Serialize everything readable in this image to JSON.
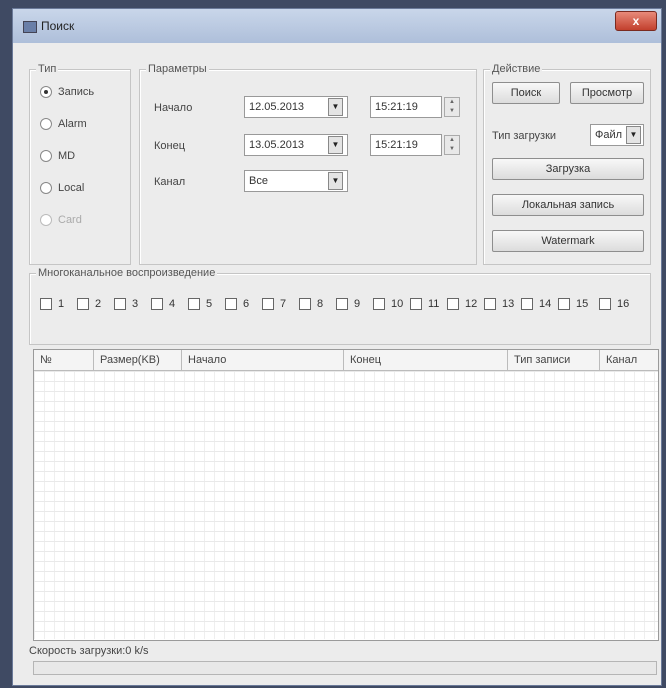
{
  "window": {
    "title": "Поиск",
    "close_label": "x"
  },
  "type_group": {
    "legend": "Тип",
    "options": [
      "Запись",
      "Alarm",
      "MD",
      "Local",
      "Card"
    ],
    "selected": "Запись",
    "disabled": [
      "Card"
    ]
  },
  "params": {
    "legend": "Параметры",
    "start_label": "Начало",
    "start_date": "12.05.2013",
    "start_time": "15:21:19",
    "end_label": "Конец",
    "end_date": "13.05.2013",
    "end_time": "15:21:19",
    "channel_label": "Канал",
    "channel_value": "Все"
  },
  "actions": {
    "legend": "Действие",
    "search_label": "Поиск",
    "view_label": "Просмотр",
    "download_type_label": "Тип загрузки",
    "download_type_value": "Файл",
    "download_label": "Загрузка",
    "local_record_label": "Локальная запись",
    "watermark_label": "Watermark"
  },
  "multichannel": {
    "legend": "Многоканальное воспроизведение",
    "channels": [
      "1",
      "2",
      "3",
      "4",
      "5",
      "6",
      "7",
      "8",
      "9",
      "10",
      "11",
      "12",
      "13",
      "14",
      "15",
      "16"
    ]
  },
  "table": {
    "columns": [
      "№",
      "Размер(KB)",
      "Начало",
      "Конец",
      "Тип записи",
      "Канал"
    ]
  },
  "status": {
    "speed": "Скорость загрузки:0 k/s"
  },
  "icons": {
    "dropdown": "chevron-down-icon",
    "spin_up": "arrow-up-icon",
    "spin_down": "arrow-down-icon",
    "app": "window-icon",
    "close": "close-icon"
  }
}
